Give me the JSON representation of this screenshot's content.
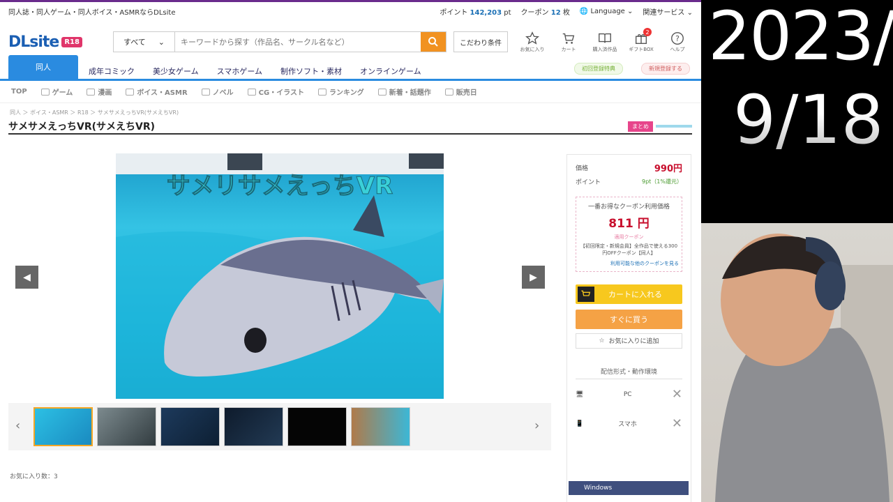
{
  "topbar": {
    "tagline": "同人誌・同人ゲーム・同人ボイス・ASMRならDLsite",
    "points_label": "ポイント",
    "points_value": "142,203",
    "points_unit": "pt",
    "coupon_label": "クーポン",
    "coupon_value": "12",
    "coupon_unit": "枚",
    "language": "Language",
    "related": "関連サービス"
  },
  "header": {
    "logo_text": "DLsite",
    "logo_badge": "R18",
    "search_category": "すべて",
    "search_placeholder": "キーワードから探す（作品名、サークル名など）",
    "cond_button": "こだわり条件",
    "icons": [
      {
        "name": "star-icon",
        "label": "お気に入り"
      },
      {
        "name": "cart-icon",
        "label": "カート"
      },
      {
        "name": "book-icon",
        "label": "購入済作品"
      },
      {
        "name": "gift-icon",
        "label": "ギフトBOX",
        "badge": "2"
      },
      {
        "name": "help-icon",
        "label": "ヘルプ"
      }
    ]
  },
  "nav": {
    "tabs": [
      "同人",
      "成年コミック",
      "美少女ゲーム",
      "スマホゲーム",
      "制作ソフト・素材",
      "オンラインゲーム"
    ],
    "pill_green": "初回登録特典",
    "pill_red": "新規登録する"
  },
  "subnav": [
    "TOP",
    "ゲーム",
    "漫画",
    "ボイス・ASMR",
    "ノベル",
    "CG・イラスト",
    "ランキング",
    "新着・話題作",
    "販売日"
  ],
  "breadcrumb": "同人 ＞ ボイス・ASMR ＞ R18 ＞ サメサメえっちVR(サメえちVR)",
  "product": {
    "title": "サメサメえっちVR(サメえちVR)",
    "tag_pink": "まとめ",
    "tag_blue": "",
    "image_caption": "サメリサメえっちVR",
    "favorites": "お気に入り数：3"
  },
  "buybox": {
    "price_label": "価格",
    "price_value": "990円",
    "point_label": "ポイント",
    "point_value": "9pt（1%還元）",
    "coupon_title": "一番お得なクーポン利用価格",
    "coupon_price": "811 円",
    "coupon_sub": "適用クーポン",
    "coupon_text": "【初回限定・新規会員】全作品で使える300円OFFクーポン【同人】",
    "coupon_link": "利用可能な他のクーポンを見る",
    "cart_button": "カートに入れる",
    "buy_button": "すぐに買う",
    "fav_button": "お気に入りに追加",
    "device_head": "配信形式・動作環境",
    "device_pc": "PC",
    "device_phone": "スマホ",
    "win_bar": "Windows"
  },
  "overlay": {
    "date_line1": "2023/",
    "date_line2": "9/18"
  },
  "colors": {
    "brand_blue": "#1b5fb3",
    "nav_blue": "#2a8be0",
    "search_orange": "#f19221",
    "price_red": "#c8102e",
    "cart_yellow": "#f7c81e",
    "buy_orange": "#f5a245"
  }
}
